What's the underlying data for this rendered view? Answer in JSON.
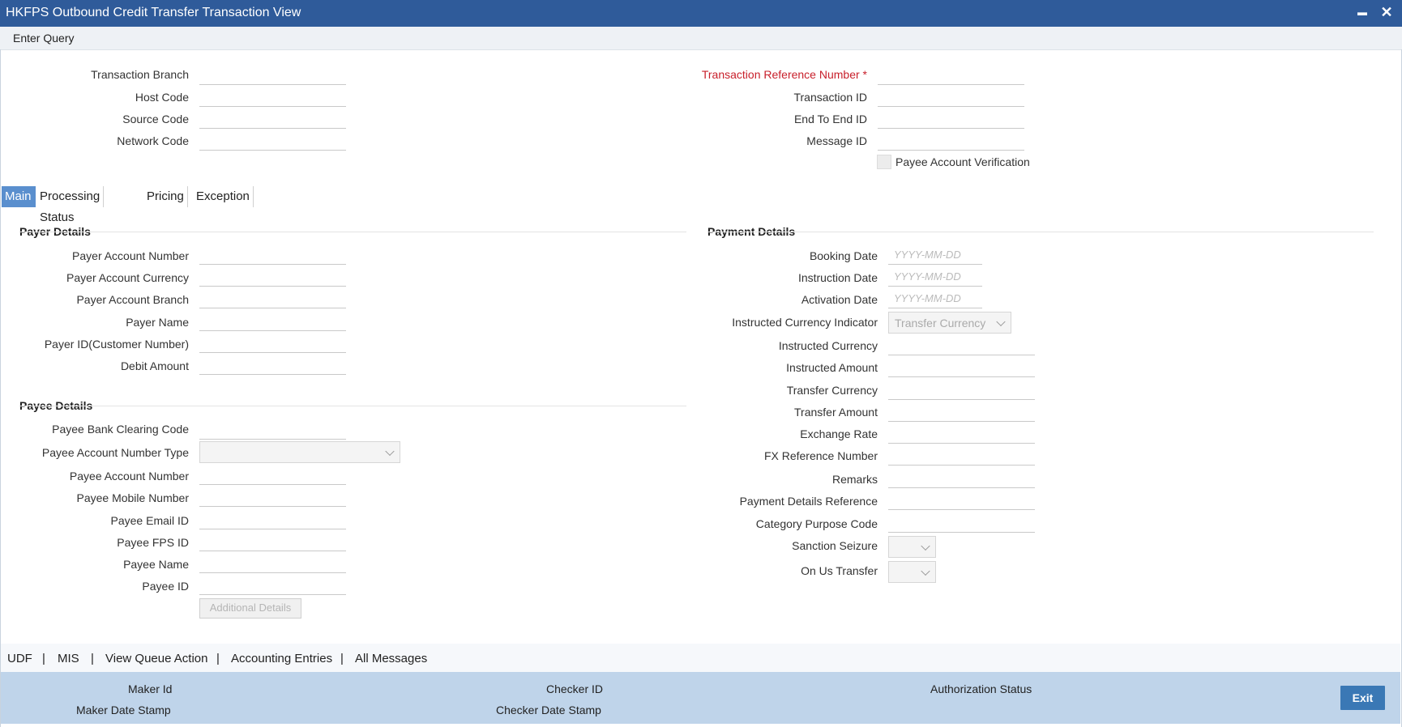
{
  "window": {
    "title": "HKFPS Outbound Credit Transfer Transaction View",
    "minimize_glyph": "▬",
    "close_glyph": "✕"
  },
  "menu": {
    "enter_query": "Enter Query"
  },
  "header_left": {
    "transaction_branch": "Transaction Branch",
    "host_code": "Host Code",
    "source_code": "Source Code",
    "network_code": "Network Code"
  },
  "header_right": {
    "transaction_reference_number": "Transaction Reference Number",
    "required_mark": "*",
    "transaction_id": "Transaction ID",
    "end_to_end_id": "End To End ID",
    "message_id": "Message ID",
    "payee_account_verification": "Payee Account Verification"
  },
  "tabs": [
    "Main",
    "Processing Status",
    "Pricing",
    "Exception"
  ],
  "payer": {
    "title": "Payer Details",
    "account_number": "Payer Account Number",
    "account_currency": "Payer Account Currency",
    "account_branch": "Payer Account Branch",
    "name": "Payer Name",
    "id": "Payer ID(Customer Number)",
    "debit_amount": "Debit Amount"
  },
  "payee": {
    "title": "Payee Details",
    "bank_clearing_code": "Payee Bank Clearing Code",
    "account_number_type": "Payee Account Number Type",
    "account_number": "Payee Account Number",
    "mobile_number": "Payee Mobile Number",
    "email_id": "Payee Email ID",
    "fps_id": "Payee FPS ID",
    "name": "Payee Name",
    "id": "Payee ID",
    "additional_details_button": "Additional Details"
  },
  "payment": {
    "title": "Payment Details",
    "booking_date": "Booking Date",
    "instruction_date": "Instruction Date",
    "activation_date": "Activation Date",
    "date_placeholder": "YYYY-MM-DD",
    "instructed_currency_indicator": "Instructed Currency Indicator",
    "instructed_currency_indicator_value": "Transfer Currency",
    "instructed_currency": "Instructed Currency",
    "instructed_amount": "Instructed Amount",
    "transfer_currency": "Transfer Currency",
    "transfer_amount": "Transfer Amount",
    "exchange_rate": "Exchange Rate",
    "fx_reference_number": "FX Reference Number",
    "remarks": "Remarks",
    "payment_details_reference": "Payment Details Reference",
    "category_purpose_code": "Category Purpose Code",
    "sanction_seizure": "Sanction Seizure",
    "on_us_transfer": "On Us Transfer"
  },
  "bottom_links": [
    "UDF",
    "MIS",
    "View Queue Action",
    "Accounting Entries",
    "All Messages"
  ],
  "link_separator": "|",
  "footer": {
    "maker_id": "Maker Id",
    "maker_date_stamp": "Maker Date Stamp",
    "checker_id": "Checker ID",
    "checker_date_stamp": "Checker Date Stamp",
    "authorization_status": "Authorization Status",
    "exit_button": "Exit"
  },
  "colors": {
    "titlebar": "#2f5b9a",
    "active_tab": "#5a8fce",
    "footer": "#bfd4ea",
    "exit_button": "#3a78b5",
    "required": "#c8202b"
  }
}
